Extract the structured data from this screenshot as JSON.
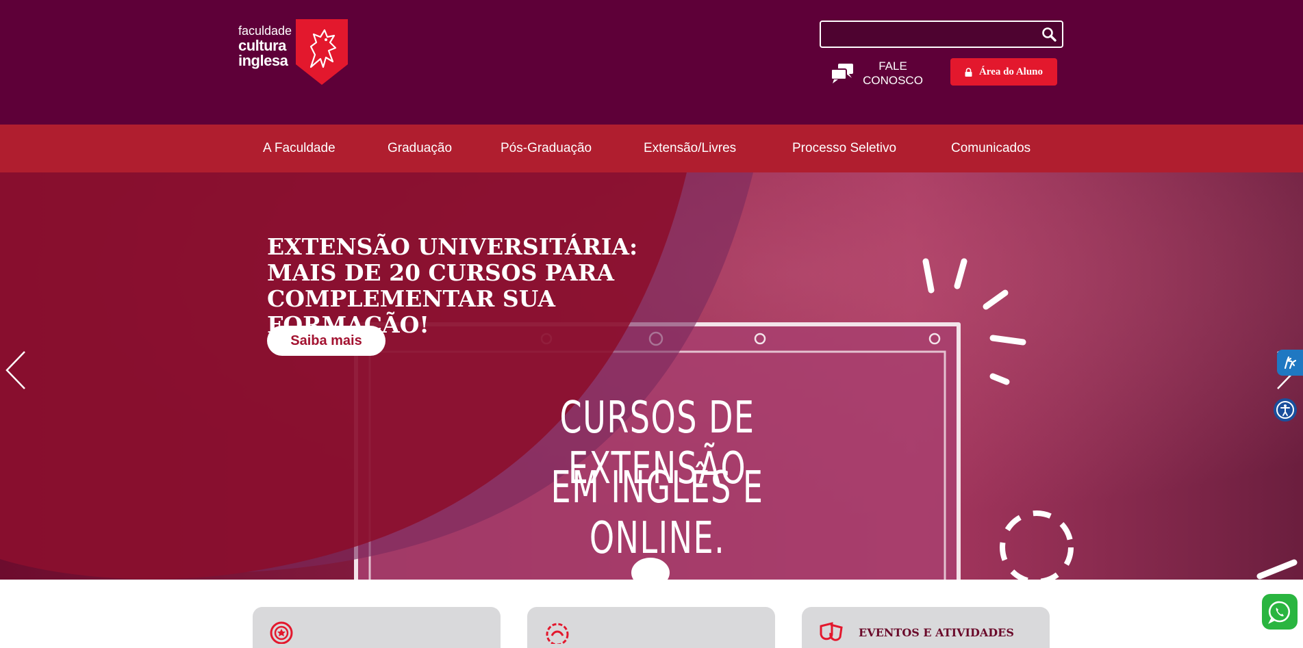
{
  "header": {
    "logo": {
      "line1": "faculdade",
      "line2": "cultura",
      "line3": "inglesa",
      "icon": "lion-shield-icon"
    },
    "search": {
      "value": "",
      "placeholder": "",
      "icon": "search-icon"
    },
    "contact": {
      "line1": "FALE",
      "line2": "CONOSCO",
      "icon": "chat-bubbles-icon"
    },
    "student_area": {
      "label": "Área do Aluno",
      "icon": "lock-icon"
    }
  },
  "nav": {
    "items": [
      {
        "label": "A Faculdade"
      },
      {
        "label": "Graduação"
      },
      {
        "label": "Pós-Graduação"
      },
      {
        "label": "Extensão/Livres"
      },
      {
        "label": "Processo Seletivo"
      },
      {
        "label": "Comunicados"
      }
    ]
  },
  "hero": {
    "title_lines": [
      "EXTENSÃO UNIVERSITÁRIA:",
      "MAIS DE 20 CURSOS PARA",
      "COMPLEMENTAR SUA FORMAÇÃO!"
    ],
    "cta": "Saiba mais",
    "board_line1": "CURSOS DE EXTENSÃO",
    "board_line2": "EM INGLÊS E ONLINE.",
    "prev_icon": "chevron-left-icon",
    "next_icon": "chevron-right-icon"
  },
  "accessibility": {
    "sign_language_icon": "sign-language-hands-icon",
    "accessibility_icon": "accessibility-person-icon"
  },
  "cards": [
    {
      "icon": "award-seal-icon",
      "title": ""
    },
    {
      "icon": "medal-icon",
      "title": ""
    },
    {
      "icon": "theater-masks-icon",
      "title": "EVENTOS E ATIVIDADES"
    }
  ],
  "whatsapp": {
    "icon": "whatsapp-icon"
  },
  "colors": {
    "header_bg": "#5e0038",
    "nav_bg": "#b01e2f",
    "accent_red": "#e3182d",
    "card_bg": "#d9d9db",
    "card_title": "#6a0a2a"
  }
}
